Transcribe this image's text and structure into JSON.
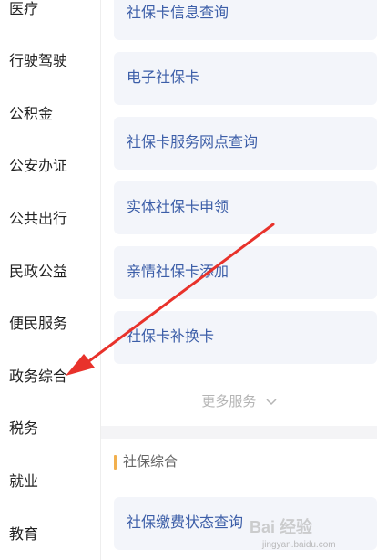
{
  "sidebar": {
    "items": [
      {
        "label": "医疗"
      },
      {
        "label": "行驶驾驶"
      },
      {
        "label": "公积金"
      },
      {
        "label": "公安办证"
      },
      {
        "label": "公共出行"
      },
      {
        "label": "民政公益"
      },
      {
        "label": "便民服务"
      },
      {
        "label": "政务综合"
      },
      {
        "label": "税务"
      },
      {
        "label": "就业"
      },
      {
        "label": "教育"
      }
    ]
  },
  "services": {
    "items": [
      {
        "label": "社保卡信息查询"
      },
      {
        "label": "电子社保卡"
      },
      {
        "label": "社保卡服务网点查询"
      },
      {
        "label": "实体社保卡申领"
      },
      {
        "label": "亲情社保卡添加"
      },
      {
        "label": "社保卡补换卡"
      }
    ],
    "more_label": "更多服务"
  },
  "section": {
    "title": "社保综合",
    "items": [
      {
        "label": "社保缴费状态查询"
      }
    ]
  },
  "watermark": {
    "main": "Bai 经验",
    "sub": "jingyan.baidu.com"
  },
  "colors": {
    "arrow": "#e8322b",
    "accent_bar": "#f2b04e",
    "card_text": "#3c5ea8"
  }
}
